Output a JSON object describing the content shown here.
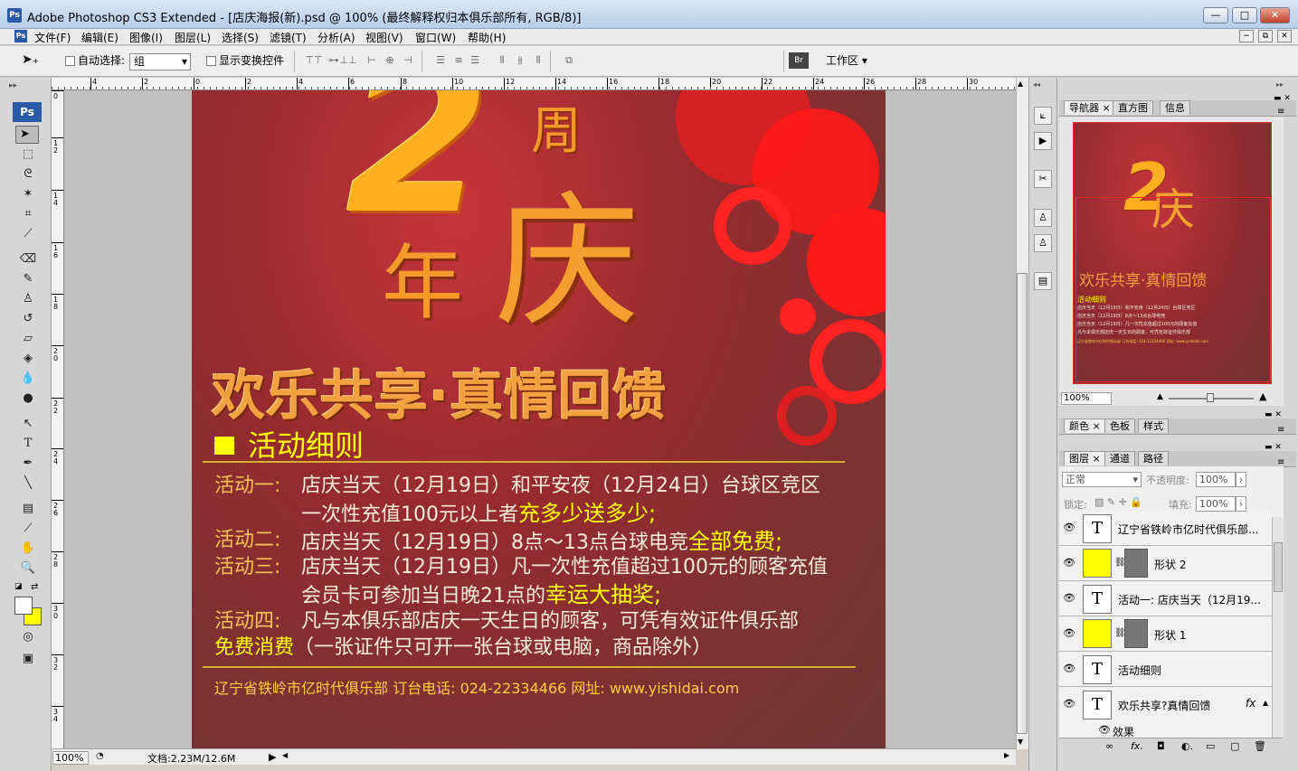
{
  "window": {
    "app_icon": "Ps",
    "title": "Adobe Photoshop CS3 Extended - [店庆海报(新).psd @ 100% (最终解释权归本俱乐部所有, RGB/8)]",
    "controls": {
      "minimize": "—",
      "maximize": "□",
      "close": "✕"
    }
  },
  "menubar": {
    "items": [
      "文件(F)",
      "编辑(E)",
      "图像(I)",
      "图层(L)",
      "选择(S)",
      "滤镜(T)",
      "分析(A)",
      "视图(V)",
      "窗口(W)",
      "帮助(H)"
    ],
    "doc_controls": [
      "−",
      "⧉",
      "✕"
    ]
  },
  "options_bar": {
    "auto_select_label": "自动选择:",
    "auto_select_value": "组",
    "show_transform_label": "显示变换控件",
    "workspace_label": "工作区 ▾"
  },
  "toolbox": {
    "logo": "Ps"
  },
  "rulers": {
    "h_labels": [
      "4",
      "2",
      "0",
      "2",
      "4",
      "6",
      "8",
      "10",
      "12",
      "14",
      "16",
      "18",
      "20",
      "22",
      "24",
      "26",
      "28",
      "30"
    ],
    "v_labels": [
      "0",
      "1 2",
      "1 4",
      "1 6",
      "1 8",
      "2 0",
      "2 2",
      "2 4",
      "2 6",
      "2 8",
      "3 0",
      "3 2",
      "3 4"
    ]
  },
  "poster": {
    "big_2": "2",
    "zhou": "周",
    "nian": "年",
    "qing": "庆",
    "slogan": "欢乐共享·真情回馈",
    "section_title": "活动细则",
    "activities": [
      {
        "label": "活动一:",
        "text": "店庆当天（12月19日）和平安夜（12月24日）台球区竞区",
        "line2_pre": "一次性充值100元以上者",
        "line2_hl": "充多少送多少;"
      },
      {
        "label": "活动二:",
        "text": "店庆当天（12月19日）8点～13点台球电竞",
        "hl": "全部免费;"
      },
      {
        "label": "活动三:",
        "text": "店庆当天（12月19日）凡一次性充值超过100元的顾客充值",
        "line2_pre": "会员卡可参加当日晚21点的",
        "line2_hl": "幸运大抽奖;"
      },
      {
        "label": "活动四:",
        "text": "凡与本俱乐部店庆一天生日的顾客，可凭有效证件俱乐部",
        "line2_hl": "免费消费",
        "line2_post": "（一张证件只可开一张台球或电脑，商品除外）"
      }
    ],
    "footer": "辽宁省铁岭市亿时代俱乐部 订台电话: 024-22334466 网址: www.yishidai.com"
  },
  "statusbar": {
    "zoom": "100%",
    "doc_info": "文档:2.23M/12.6M"
  },
  "navigator_panel": {
    "tabs": [
      "导航器",
      "直方图",
      "信息"
    ],
    "zoom": "100%"
  },
  "color_panel": {
    "tabs": [
      "颜色",
      "色板",
      "样式"
    ]
  },
  "layers_panel": {
    "tabs": [
      "图层",
      "通道",
      "路径"
    ],
    "blend_mode": "正常",
    "opacity_label": "不透明度:",
    "opacity_value": "100%",
    "lock_label": "锁定:",
    "fill_label": "填充:",
    "fill_value": "100%",
    "layers": [
      {
        "type": "text",
        "name": "辽宁省铁岭市亿时代俱乐部..."
      },
      {
        "type": "shape",
        "name": "形状 2"
      },
      {
        "type": "text",
        "name": "活动一: 店庆当天（12月19..."
      },
      {
        "type": "shape",
        "name": "形状 1"
      },
      {
        "type": "text",
        "name": "活动细则"
      },
      {
        "type": "text",
        "name": "欢乐共享?真情回馈",
        "fx": "fx"
      }
    ],
    "effect_label": "效果",
    "bottom_icons": [
      "∞",
      "fx.",
      "◘",
      "◐.",
      "▭",
      "▢",
      "🗑"
    ]
  },
  "colors": {
    "poster_yellow": "#ffff00",
    "poster_orange": "#f6c255",
    "poster_cream": "#f4ecd8",
    "title_orange": "#e8862a"
  }
}
